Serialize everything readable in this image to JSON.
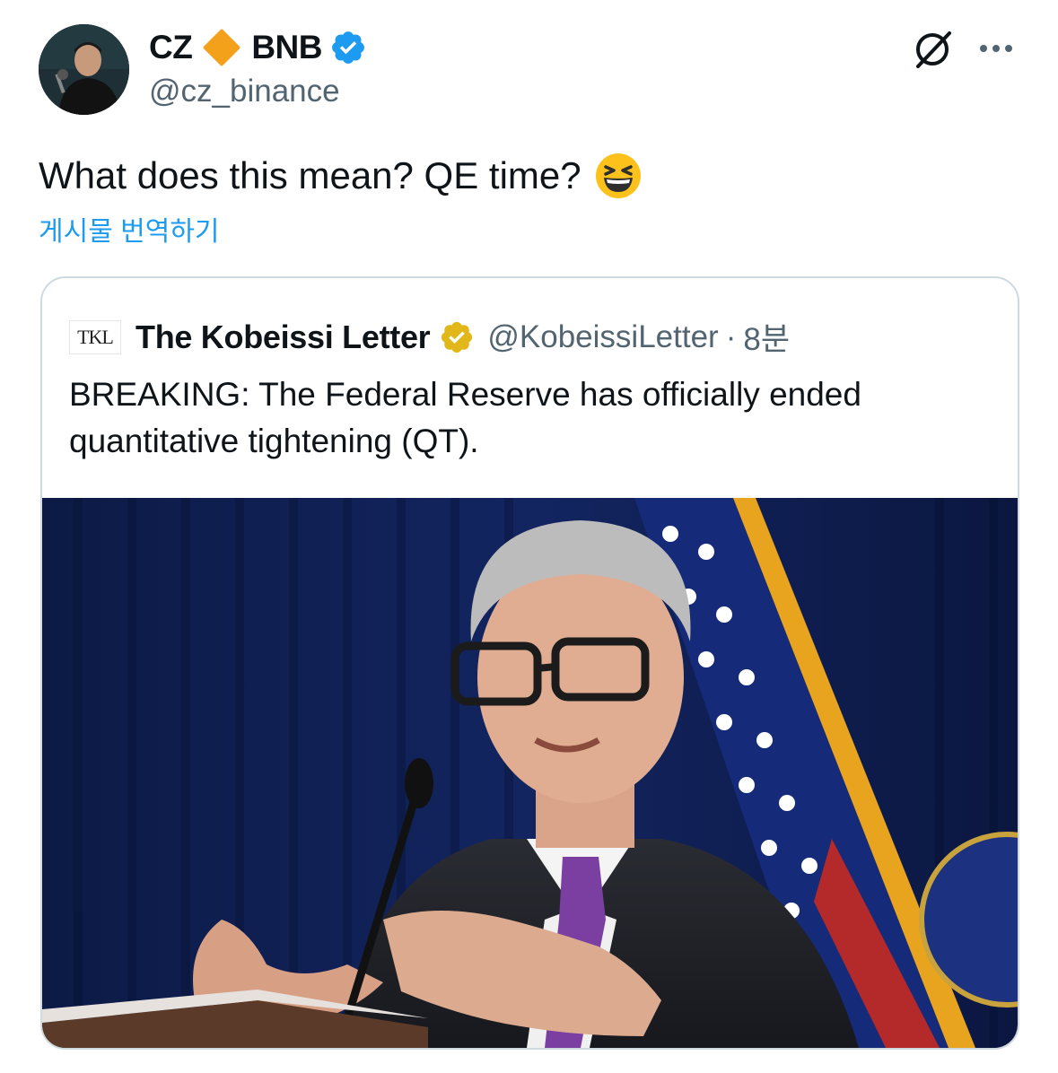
{
  "author": {
    "name": "CZ",
    "name_suffix": "BNB",
    "handle": "@cz_binance",
    "verified": true,
    "avatar_icon": "avatar-photo"
  },
  "actions": {
    "grok_icon": "grok-icon",
    "more_icon": "more-dots-icon"
  },
  "tweet": {
    "text": "What does this mean? QE time?",
    "emoji": "grinning-squinting-face",
    "translate_label": "게시물 번역하기"
  },
  "quote": {
    "logo_text": "TKL",
    "name": "The Kobeissi Letter",
    "handle": "@KobeissiLetter",
    "separator": "·",
    "time": "8분",
    "text": "BREAKING: The Federal Reserve has officially ended quantitative tightening (QT).",
    "badge_color": "#e2b719",
    "image": "press-conference-photo"
  },
  "colors": {
    "link": "#1d9bf0",
    "secondary_text": "#536471",
    "verified_blue": "#1d9bf0",
    "bnb_diamond": "#f3a01b",
    "gold_badge": "#e2b719"
  }
}
